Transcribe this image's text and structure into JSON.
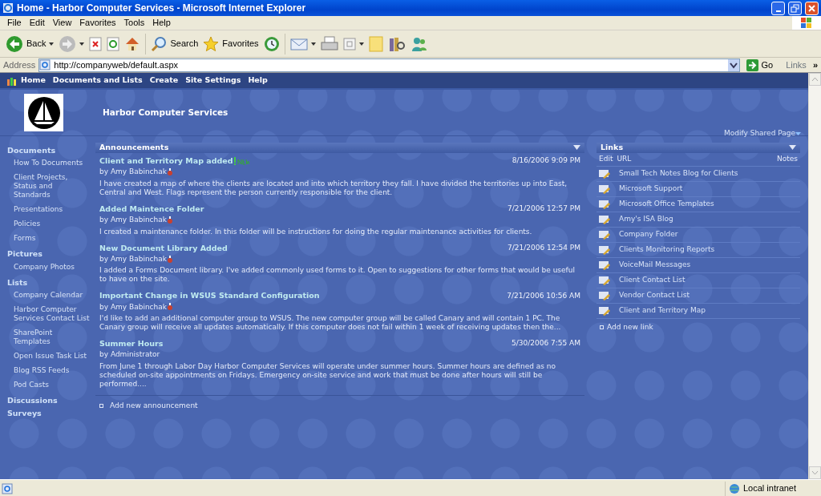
{
  "window": {
    "title": "Home - Harbor Computer Services - Microsoft Internet Explorer"
  },
  "menu": [
    "File",
    "Edit",
    "View",
    "Favorites",
    "Tools",
    "Help"
  ],
  "toolbar": {
    "back_label": "Back",
    "search_label": "Search",
    "favorites_label": "Favorites"
  },
  "address": {
    "label": "Address",
    "url": "http://companyweb/default.aspx",
    "go": "Go",
    "links": "Links",
    "more": "»"
  },
  "site_nav": [
    "Home",
    "Documents and Lists",
    "Create",
    "Site Settings",
    "Help"
  ],
  "site_title": "Harbor Computer Services",
  "modify_page": "Modify Shared Page",
  "sidebar": [
    {
      "label": "Documents",
      "children": [
        {
          "label": "How To Documents"
        },
        {
          "label": "Client Projects, Status and Standards"
        },
        {
          "label": "Presentations"
        },
        {
          "label": "Policies"
        },
        {
          "label": "Forms"
        }
      ]
    },
    {
      "label": "Pictures",
      "children": [
        {
          "label": "Company Photos"
        }
      ]
    },
    {
      "label": "Lists",
      "children": [
        {
          "label": "Company Calendar"
        },
        {
          "label": "Harbor Computer Services Contact List"
        },
        {
          "label": "SharePoint Templates"
        },
        {
          "label": "Open Issue Task List"
        },
        {
          "label": "Blog RSS Feeds"
        },
        {
          "label": "Pod Casts"
        }
      ]
    },
    {
      "label": "Discussions"
    },
    {
      "label": "Surveys"
    }
  ],
  "announcements": {
    "title": "Announcements",
    "add": "Add new announcement",
    "items": [
      {
        "title": "Client and Territory Map added",
        "is_new": true,
        "author": "by Amy Babinchak",
        "presence": true,
        "date": "8/16/2006 9:09 PM",
        "body": "I have created a map of where the clients are located and into which territory they fall. I have divided the territories up into East, Central and West. Flags represent the person currently responsible for the client."
      },
      {
        "title": "Added Maintence Folder",
        "is_new": false,
        "author": "by Amy Babinchak",
        "presence": true,
        "date": "7/21/2006 12:57 PM",
        "body": "I created a maintenance folder. In this folder will be instructions for doing the regular maintenance activities for clients."
      },
      {
        "title": "New Document Library Added",
        "is_new": false,
        "author": "by Amy Babinchak",
        "presence": true,
        "date": "7/21/2006 12:54 PM",
        "body": "I added a Forms Document library. I've added commonly used forms to it. Open to suggestions for other forms that would be useful to have on the site."
      },
      {
        "title": "Important Change in WSUS Standard Configuration",
        "is_new": false,
        "author": "by Amy Babinchak",
        "presence": true,
        "date": "7/21/2006 10:56 AM",
        "body": "I'd like to add an additional computer group to WSUS. The new computer group will be called Canary and will contain 1 PC. The Canary group will receive all updates automatically. If this computer does not fail within 1 week of receiving updates then the..."
      },
      {
        "title": "Summer Hours",
        "is_new": false,
        "author": "by Administrator",
        "presence": false,
        "date": "5/30/2006 7:55 AM",
        "body": "From June 1 through Labor Day Harbor Computer Services will operate under summer hours. Summer hours are defined as no scheduled on-site appointments on Fridays. Emergency on-site service and work that must be done after hours will still be performed...."
      }
    ]
  },
  "links": {
    "title": "Links",
    "columns": [
      "Edit",
      "URL",
      "Notes"
    ],
    "add": "Add new link",
    "items": [
      "Small Tech Notes Blog for Clients",
      "Microsoft Support",
      "Microsoft Office Templates",
      "Amy's ISA Blog",
      "Company Folder",
      "Clients Monitoring Reports",
      "VoiceMail Messages",
      "Client Contact List",
      "Vendor Contact List",
      "Client and Territory Map"
    ]
  },
  "status_bar": {
    "zone": "Local intranet"
  }
}
